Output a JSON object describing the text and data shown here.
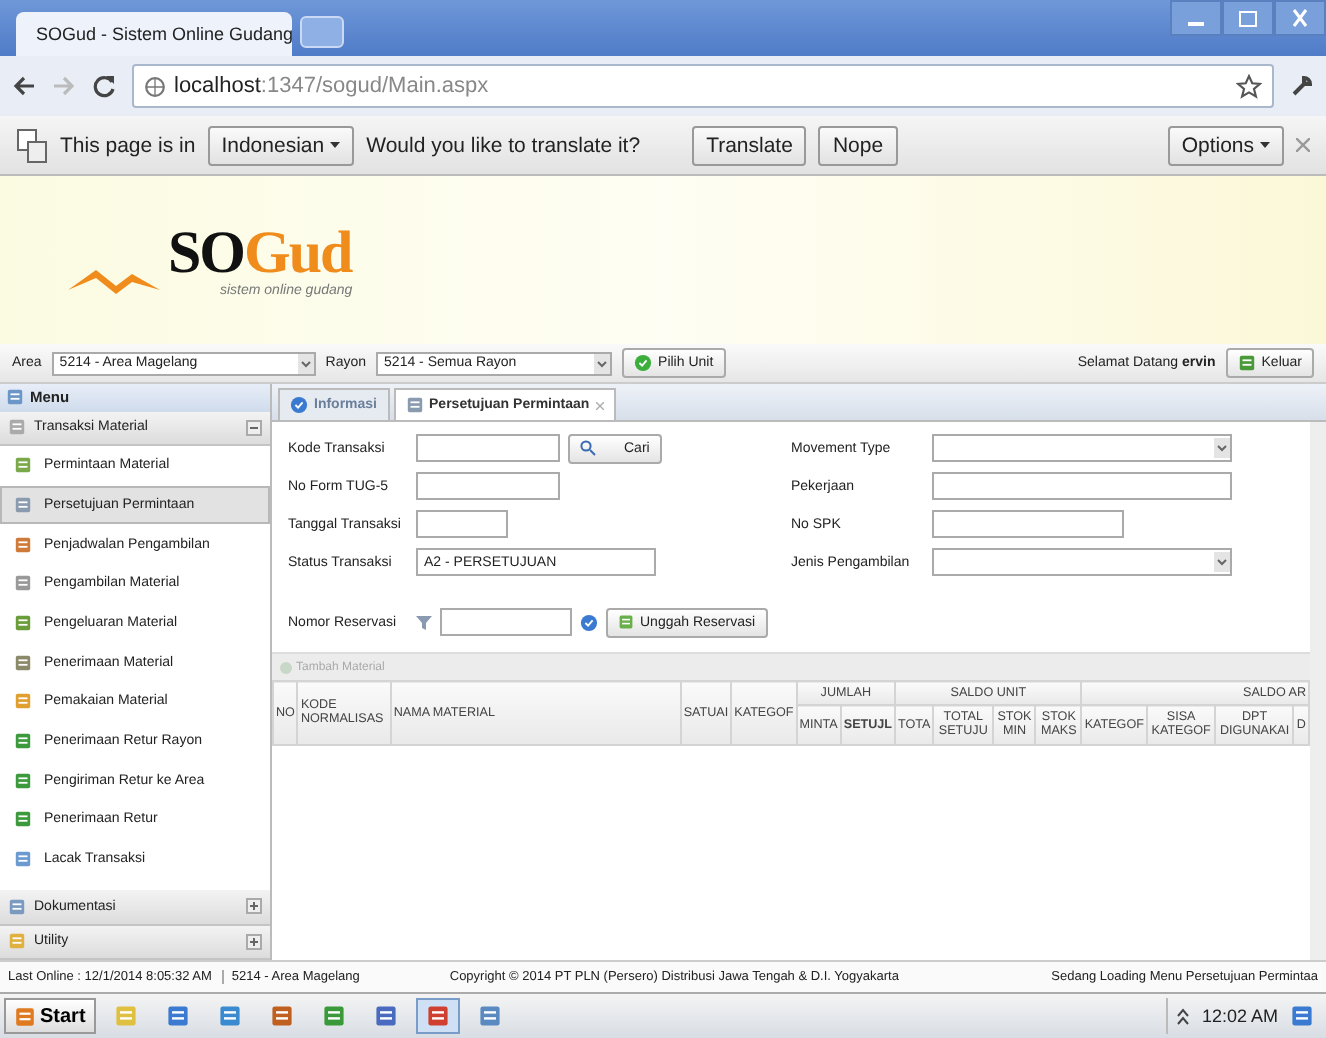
{
  "browser": {
    "tab_title": "SOGud - Sistem Online Gudang",
    "address_host": "localhost",
    "address_path": ":1347/sogud/Main.aspx"
  },
  "translate_bar": {
    "prefix": "This page is in",
    "language": "Indonesian",
    "question": "Would you like to translate it?",
    "buttons": [
      "Translate",
      "Nope"
    ],
    "options": "Options"
  },
  "logo": {
    "part_dark": "SO",
    "part_orange": "Gud",
    "tagline": "sistem online gudang"
  },
  "top_bar": {
    "area_label": "Area",
    "area_value": "5214 - Area Magelang",
    "rayon_label": "Rayon",
    "rayon_value": "5214 - Semua Rayon",
    "pick_button": "Pilih Unit",
    "welcome": "Selamat Datang **ervin**",
    "logout_button": "Keluar"
  },
  "sidebar": {
    "title": "Menu",
    "groups": [
      {
        "title": "Transaksi Material",
        "expanded": true,
        "items": [
          {
            "label": "Permintaan Material",
            "selected": false
          },
          {
            "label": "Persetujuan Permintaan",
            "selected": true
          },
          {
            "label": "Penjadwalan Pengambilan",
            "selected": false
          },
          {
            "label": "Pengambilan Material",
            "selected": false
          },
          {
            "label": "Pengeluaran Material",
            "selected": false
          },
          {
            "label": "Penerimaan Material",
            "selected": false
          },
          {
            "label": "Pemakaian Material",
            "selected": false
          },
          {
            "label": "Penerimaan Retur Rayon",
            "selected": false
          },
          {
            "label": "Pengiriman Retur ke Area",
            "selected": false
          },
          {
            "label": "Penerimaan Retur",
            "selected": false
          },
          {
            "label": "Lacak Transaksi",
            "selected": false
          }
        ]
      },
      {
        "title": "Dokumentasi",
        "expanded": false
      },
      {
        "title": "Utility",
        "expanded": false
      }
    ]
  },
  "tabs": [
    {
      "label": "Informasi",
      "selected": false
    },
    {
      "label": "Persetujuan Permintaan",
      "selected": true
    }
  ],
  "form": {
    "left": [
      {
        "label": "Kode Transaksi",
        "kind": "search",
        "button": "Cari"
      },
      {
        "label": "No Form TUG-5",
        "kind": "text"
      },
      {
        "label": "Tanggal Transaksi",
        "kind": "short"
      },
      {
        "label": "Status Transaksi",
        "kind": "text",
        "value": "A2 - PERSETUJUAN"
      }
    ],
    "right": [
      {
        "label": "Movement Type",
        "kind": "select"
      },
      {
        "label": "Pekerjaan",
        "kind": "text"
      },
      {
        "label": "No SPK",
        "kind": "short"
      },
      {
        "label": "Jenis Pengambilan",
        "kind": "select"
      }
    ],
    "reservation": {
      "label": "Nomor Reservasi",
      "button": "Unggah Reservasi"
    }
  },
  "toolbar": {
    "add_button": "Tambah Material",
    "disabled": true
  },
  "table": {
    "columns": [
      {
        "label": "NO"
      },
      {
        "label": "KODE NORMALISAS"
      },
      {
        "label": "NAMA MATERIAL"
      },
      {
        "label": "SATUAI"
      },
      {
        "label": "KATEGOF"
      },
      {
        "label": "JUMLAH",
        "children": [
          "MINTA",
          "SETUJL"
        ]
      },
      {
        "label": "SALDO UNIT",
        "children": [
          "TOTA",
          "TOTAL SETUJU",
          "STOK MIN",
          "STOK MAKS"
        ]
      },
      {
        "label": "SALDO AR",
        "children": [
          "KATEGOF",
          "SISA KATEGOF",
          "DPT DIGUNAKAI",
          "D"
        ]
      }
    ]
  },
  "status_bar": {
    "last_online": "Last Online :  12/1/2014 8:05:32 AM",
    "unit": "5214 - Area Magelang",
    "copyright": "Copyright © 2014 PT PLN (Persero) Distribusi Jawa Tengah & D.I. Yogyakarta",
    "message": "Sedang Loading Menu Persetujuan Permintaa"
  },
  "taskbar": {
    "start": "Start",
    "apps": [
      {
        "selected": false
      },
      {
        "selected": false
      },
      {
        "selected": false
      },
      {
        "selected": false
      },
      {
        "selected": false
      },
      {
        "selected": false
      },
      {
        "selected": true
      },
      {
        "selected": false
      }
    ],
    "clock": "12:02 AM"
  }
}
